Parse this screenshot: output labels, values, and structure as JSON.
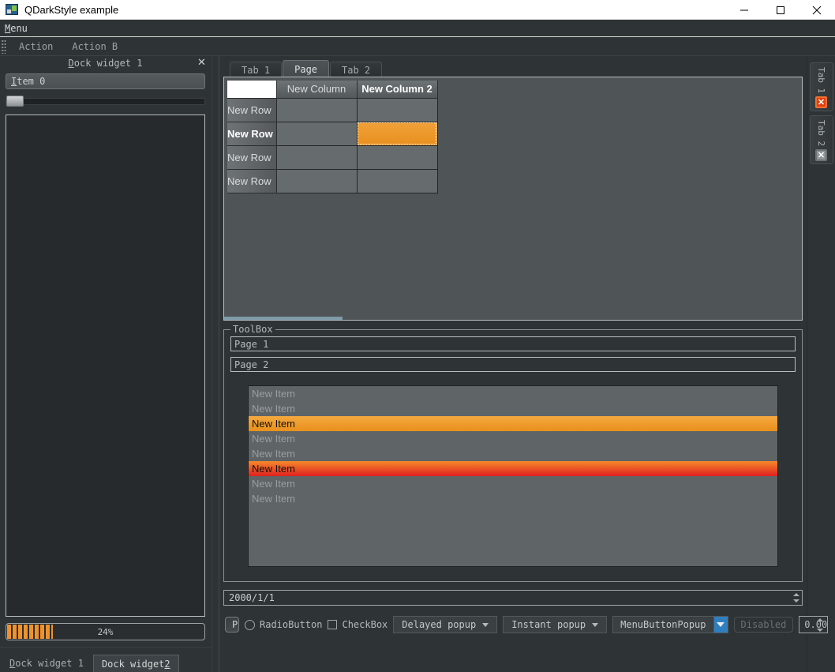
{
  "window": {
    "title": "QDarkStyle example",
    "icon": "app-icon",
    "minimize": "–",
    "maximize": "□",
    "close": "✕"
  },
  "menubar": {
    "items": [
      {
        "mnemonic": "M",
        "rest": "enu"
      }
    ]
  },
  "toolbar": {
    "actions": [
      "Action",
      "Action B"
    ]
  },
  "left_dock": {
    "title_mnemonic": "D",
    "title_rest": "ock widget 1",
    "close_label": "✕",
    "combo_value_mnemonic": "I",
    "combo_value_rest": "tem 0",
    "slider_value": 0,
    "progress": {
      "percent": 24,
      "label": "24%"
    },
    "tabs": [
      {
        "mnemonic": "D",
        "pre": "",
        "rest": "ock widget 1",
        "selected": false
      },
      {
        "pre": "Dock widget ",
        "mnemonic": "2",
        "rest": "",
        "selected": true
      }
    ]
  },
  "central": {
    "tabs": [
      {
        "label": "Tab 1",
        "selected": false
      },
      {
        "label": "Page",
        "selected": true
      },
      {
        "label": "Tab 2",
        "selected": false
      }
    ],
    "table": {
      "corner": "",
      "columns": [
        {
          "label": "New Column",
          "bold": false
        },
        {
          "label": "New Column 2",
          "bold": true
        }
      ],
      "rows": [
        {
          "header": "New Row",
          "bold": false,
          "cells": [
            {
              "value": "",
              "selected": false
            },
            {
              "value": "",
              "selected": false
            }
          ]
        },
        {
          "header": "New Row",
          "bold": true,
          "cells": [
            {
              "value": "",
              "selected": false
            },
            {
              "value": "",
              "selected": true
            }
          ]
        },
        {
          "header": "New Row",
          "bold": false,
          "cells": [
            {
              "value": "",
              "selected": false
            },
            {
              "value": "",
              "selected": false
            }
          ]
        },
        {
          "header": "New Row",
          "bold": false,
          "cells": [
            {
              "value": "",
              "selected": false
            },
            {
              "value": "",
              "selected": false
            }
          ]
        }
      ]
    },
    "groupbox": {
      "title": "ToolBox",
      "pages": [
        "Page 1",
        "Page 2"
      ],
      "list_items": [
        {
          "label": "New Item",
          "state": "normal"
        },
        {
          "label": "New Item",
          "state": "normal"
        },
        {
          "label": "New Item",
          "state": "selected"
        },
        {
          "label": "New Item",
          "state": "normal"
        },
        {
          "label": "New Item",
          "state": "normal"
        },
        {
          "label": "New Item",
          "state": "hover"
        },
        {
          "label": "New Item",
          "state": "normal"
        },
        {
          "label": "New Item",
          "state": "normal"
        }
      ]
    },
    "date_edit": {
      "value": "2000/1/1"
    },
    "bottom_bar": {
      "push_button": "PushButton",
      "radio_button": "RadioButton",
      "check_box": "CheckBox",
      "delayed_popup": "Delayed popup",
      "instant_popup": "Instant popup",
      "menu_button_popup": "MenuButtonPopup",
      "disabled_button": "Disabled",
      "spin_value": "0.00",
      "dots_button": "..."
    }
  },
  "right_tabs": [
    {
      "label": "Tab 1",
      "close_state": "hot"
    },
    {
      "label": "Tab 2",
      "close_state": "cold"
    }
  ],
  "colors": {
    "accent_orange": "#e8901f",
    "accent_red": "#e02020",
    "background": "#2e3436",
    "panel": "#4f5456",
    "text": "#c8cbcd",
    "highlight_blue": "#2f7fbf"
  }
}
